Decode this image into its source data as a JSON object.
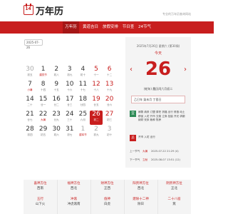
{
  "header": {
    "logo_number": "14",
    "logo_text": "万年历",
    "tagline": "专业的万年历查询网站"
  },
  "nav": {
    "items": [
      {
        "label": "万年历",
        "active": true
      },
      {
        "label": "黄道吉日",
        "active": false
      },
      {
        "label": "放假安排",
        "active": false
      },
      {
        "label": "节日查",
        "active": false
      },
      {
        "label": "24节气",
        "active": false
      }
    ]
  },
  "calendar": {
    "selected_date": "2025-07-26",
    "rows": [
      [
        {
          "d": "30",
          "l": "初五",
          "cls": "other"
        },
        {
          "d": "1",
          "l": "建党节",
          "cls": "holiday"
        },
        {
          "d": "2",
          "l": "初八",
          "cls": ""
        },
        {
          "d": "3",
          "l": "初九",
          "cls": ""
        },
        {
          "d": "4",
          "l": "初十",
          "cls": ""
        },
        {
          "d": "5",
          "l": "十一",
          "cls": "weekend"
        },
        {
          "d": "6",
          "l": "十二",
          "cls": "weekend"
        }
      ],
      [
        {
          "d": "7",
          "l": "小暑",
          "cls": "holiday"
        },
        {
          "d": "8",
          "l": "十四",
          "cls": ""
        },
        {
          "d": "9",
          "l": "十五",
          "cls": ""
        },
        {
          "d": "10",
          "l": "十六",
          "cls": ""
        },
        {
          "d": "11",
          "l": "十七",
          "cls": ""
        },
        {
          "d": "12",
          "l": "十八",
          "cls": "weekend"
        },
        {
          "d": "13",
          "l": "十九",
          "cls": "weekend"
        }
      ],
      [
        {
          "d": "14",
          "l": "二十",
          "cls": ""
        },
        {
          "d": "15",
          "l": "廿一",
          "cls": ""
        },
        {
          "d": "16",
          "l": "廿二",
          "cls": ""
        },
        {
          "d": "17",
          "l": "廿三",
          "cls": ""
        },
        {
          "d": "18",
          "l": "廿四",
          "cls": ""
        },
        {
          "d": "19",
          "l": "廿五",
          "cls": "weekend"
        },
        {
          "d": "20",
          "l": "廿六",
          "cls": "weekend"
        }
      ],
      [
        {
          "d": "21",
          "l": "廿七",
          "cls": ""
        },
        {
          "d": "22",
          "l": "大暑",
          "cls": "holiday"
        },
        {
          "d": "23",
          "l": "廿九",
          "cls": ""
        },
        {
          "d": "24",
          "l": "三十",
          "cls": ""
        },
        {
          "d": "25",
          "l": "六月",
          "cls": ""
        },
        {
          "d": "26",
          "l": "初二",
          "cls": "today"
        },
        {
          "d": "27",
          "l": "初三",
          "cls": "weekend"
        }
      ],
      [
        {
          "d": "28",
          "l": "初四",
          "cls": ""
        },
        {
          "d": "29",
          "l": "初五",
          "cls": ""
        },
        {
          "d": "30",
          "l": "初六",
          "cls": ""
        },
        {
          "d": "31",
          "l": "初七",
          "cls": ""
        },
        {
          "d": "1",
          "l": "建军节",
          "cls": "other holiday"
        },
        {
          "d": "2",
          "l": "初九",
          "cls": "other"
        },
        {
          "d": "3",
          "l": "初十",
          "cls": "other"
        }
      ]
    ]
  },
  "detail": {
    "head": "2025年7月26日 星期六 (第30周)",
    "sub": "今天",
    "day": "26",
    "lunar": "(蛇年) 農历闰六月初二",
    "ganzhi": "乙巳年 癸未月 丁酉日",
    "yi_label": "宜",
    "yi_text": "嫁娶 纳采 订盟 祭祀 祈福 出行 修造 动土 移徙 入宅 开市 交易 立券 挂匾 开光 求嗣 纳财 安床 栽种 牧养",
    "ji_label": "忌",
    "ji_text": "开市 入宅 出行",
    "prev_label": "上一节气",
    "prev_name": "大暑",
    "prev_time": "2025-07-22 21:29 (4)",
    "next_label": "下一节气",
    "next_name": "立秋",
    "next_time": "2025-08-07 13:51 (12)",
    "prev_arrow": "‹",
    "next_arrow": "›"
  },
  "bottom": {
    "row1": [
      {
        "h": "喜神方位",
        "v": "西南"
      },
      {
        "h": "福神方位",
        "v": "西北"
      },
      {
        "h": "财神方位",
        "v": "正西"
      },
      {
        "h": "阳贵神方位",
        "v": "西北"
      },
      {
        "h": "阴贵神方位",
        "v": "正北"
      }
    ],
    "row2": [
      {
        "h": "五行",
        "v": "山下火"
      },
      {
        "h": "冲煞",
        "v": "冲虎煞南"
      },
      {
        "h": "值神",
        "v": "白虎"
      },
      {
        "h": "建除十二神",
        "v": "除日"
      },
      {
        "h": "二十八宿",
        "v": "箕"
      }
    ]
  },
  "colors": {
    "accent": "#c81e1e",
    "nav_active": "#a51616",
    "yi": "#2e8b57"
  }
}
